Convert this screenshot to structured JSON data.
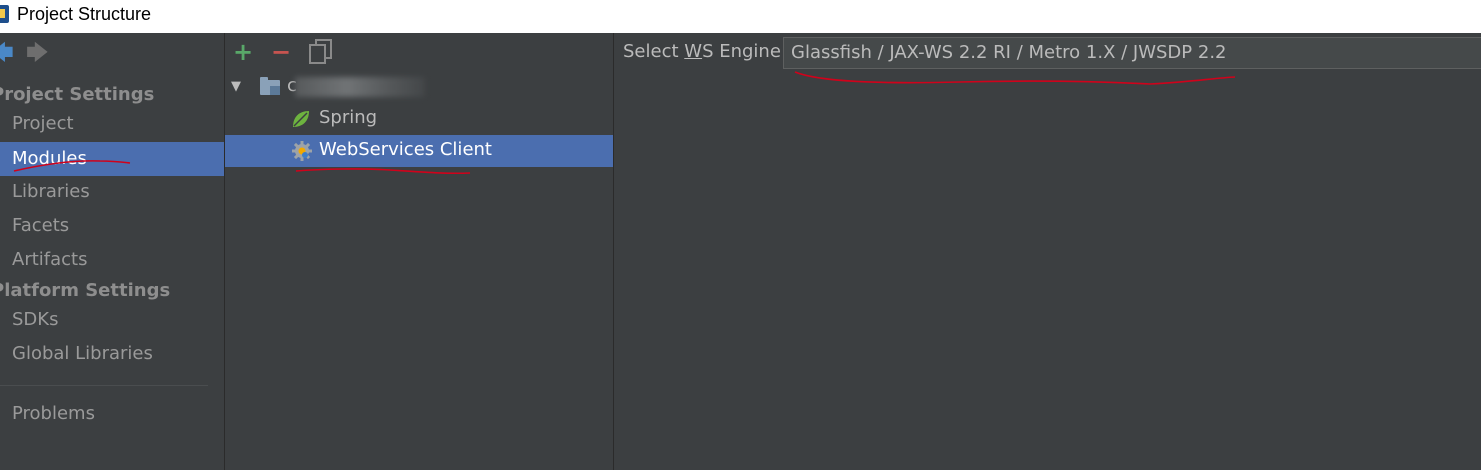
{
  "window": {
    "title": "Project Structure"
  },
  "sidebar": {
    "project_settings_header": "Project Settings",
    "platform_settings_header": "Platform Settings",
    "project_items": [
      "Project",
      "Modules",
      "Libraries",
      "Facets",
      "Artifacts"
    ],
    "platform_items": [
      "SDKs",
      "Global Libraries"
    ],
    "problems": "Problems",
    "selected": "Modules"
  },
  "tree": {
    "module_name": "c",
    "children": [
      "Spring",
      "WebServices Client"
    ],
    "selected": "WebServices Client"
  },
  "ws_engine": {
    "label_prefix": "Select ",
    "label_mnemonic": "W",
    "label_suffix": "S Engine",
    "value": "Glassfish / JAX-WS 2.2 RI / Metro 1.X / JWSDP 2.2"
  },
  "colors": {
    "background": "#3c3f41",
    "selection": "#4b6eaf",
    "annotation_red": "#d0021b",
    "add_green": "#59a869",
    "remove_red": "#c75450"
  },
  "icons": [
    "back-arrow-icon",
    "forward-arrow-icon",
    "add-icon",
    "remove-icon",
    "copy-icon",
    "chevron-down-icon",
    "folder-icon",
    "spring-leaf-icon",
    "gear-icon"
  ]
}
